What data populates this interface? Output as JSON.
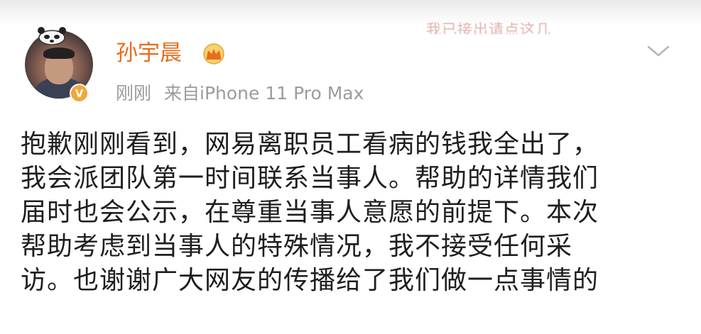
{
  "post": {
    "author": {
      "name": "孙宇晨",
      "verified": true,
      "crown_badge": "crown-icon"
    },
    "meta": {
      "time": "刚刚",
      "source": "来自iPhone 11 Pro Max"
    },
    "header_decoration_text": "我已接出请点这几",
    "body_lines": [
      "抱歉刚刚看到，网易离职员工看病的钱我全出了，",
      "我会派团队第一时间联系当事人。帮助的详情我们",
      "届时也会公示，在尊重当事人意愿的前提下。本次",
      "帮助考虑到当事人的特殊情况，我不接受任何采",
      "访。也谢谢广大网友的传播给了我们做一点事情的"
    ],
    "menu_icon": "chevron-down-icon"
  },
  "colors": {
    "username": "#e86c1e",
    "meta": "#9b9b9b",
    "body_text": "#1e1e1e",
    "verified_badge": "#f3a63b"
  }
}
